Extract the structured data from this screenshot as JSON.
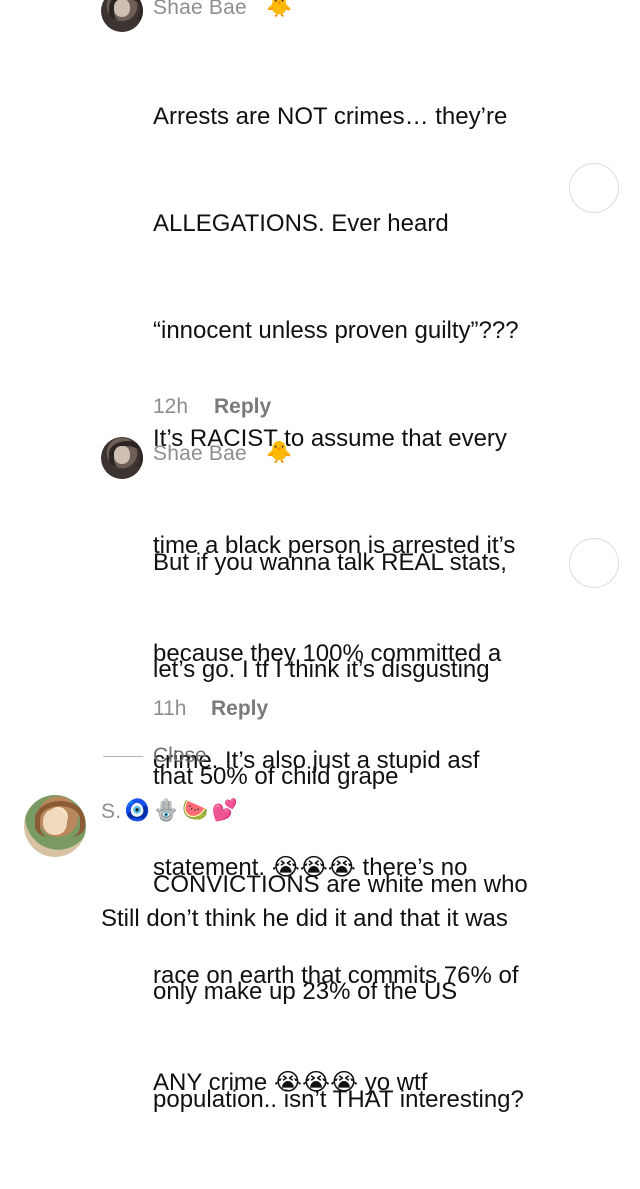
{
  "comments": [
    {
      "username": "Shae Bae",
      "badge": "🐥",
      "lines": [
        "Arrests are NOT crimes… they’re",
        "ALLEGATIONS. Ever heard",
        "“innocent unless proven guilty”???",
        "It’s RACIST to assume that every",
        "time a black person is arrested it’s",
        "because they 100% committed a",
        "crime. It’s also just a stupid asf",
        "statement. 😭😭😭 there’s no",
        "race on earth that commits 76% of",
        "ANY crime 😭😭😭 yo wtf"
      ],
      "time": "12h",
      "reply_label": "Reply"
    },
    {
      "username": "Shae Bae",
      "badge": "🐥",
      "lines": [
        "But if you wanna talk REAL stats,",
        "let’s go. I tf I think it’s disgusting",
        "that 50% of child grape",
        "CONVICTIONS are white men who",
        "only make up 23% of the US",
        "population.. isn’t THAT interesting?"
      ],
      "time": "11h",
      "reply_label": "Reply"
    },
    {
      "username": "S.",
      "badges": "🧿🪬🍉💕",
      "lines": [
        "Still don’t think he did it and that it was"
      ]
    }
  ],
  "close_label": "Close"
}
